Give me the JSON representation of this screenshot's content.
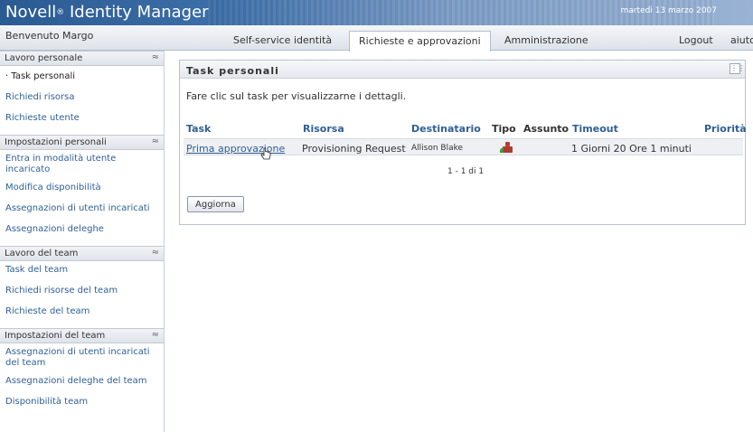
{
  "header": {
    "brand": "Novell",
    "brand_reg": "®",
    "brand_product": "Identity Manager",
    "date": "martedì 13 marzo 2007"
  },
  "nav": {
    "welcome": "Benvenuto Margo",
    "tabs": [
      {
        "label": "Self-service identità",
        "active": false
      },
      {
        "label": "Richieste e approvazioni",
        "active": true
      },
      {
        "label": "Amministrazione",
        "active": false
      }
    ],
    "logout": "Logout",
    "help": "aiuto"
  },
  "sidebar": {
    "sections": [
      {
        "title": "Lavoro personale",
        "items": [
          "Task personali",
          "Richiedi risorsa",
          "Richieste utente"
        ],
        "current": 0
      },
      {
        "title": "Impostazioni personali",
        "items": [
          "Entra in modalità utente incaricato",
          "Modifica disponibilità",
          "Assegnazioni di utenti incaricati",
          "Assegnazioni deleghe"
        ]
      },
      {
        "title": "Lavoro del team",
        "items": [
          "Task del team",
          "Richiedi risorse del team",
          "Richieste del team"
        ]
      },
      {
        "title": "Impostazioni del team",
        "items": [
          "Assegnazioni di utenti incaricati del team",
          "Assegnazioni deleghe del team",
          "Disponibilità team"
        ]
      }
    ]
  },
  "panel": {
    "title": "Task personali",
    "instructions": "Fare clic sul task per visualizzarne i dettagli.",
    "columns": {
      "task": "Task",
      "resource": "Risorsa",
      "recipient": "Destinatario",
      "type": "Tipo",
      "assigned": "Assunto",
      "timeout": "Timeout",
      "priority": "Priorità"
    },
    "rows": [
      {
        "task": "Prima approvazione",
        "resource": "Provisioning Request",
        "recipient": "Allison Blake",
        "type_icon": "provisioning-icon",
        "assigned": "",
        "timeout": "1 Giorni 20 Ore 1 minuti",
        "priority": ""
      }
    ],
    "pagination": "1 - 1 di 1",
    "refresh_button": "Aggiorna"
  },
  "colors": {
    "link": "#2f5f98",
    "header_blue": "#2a5a92"
  }
}
